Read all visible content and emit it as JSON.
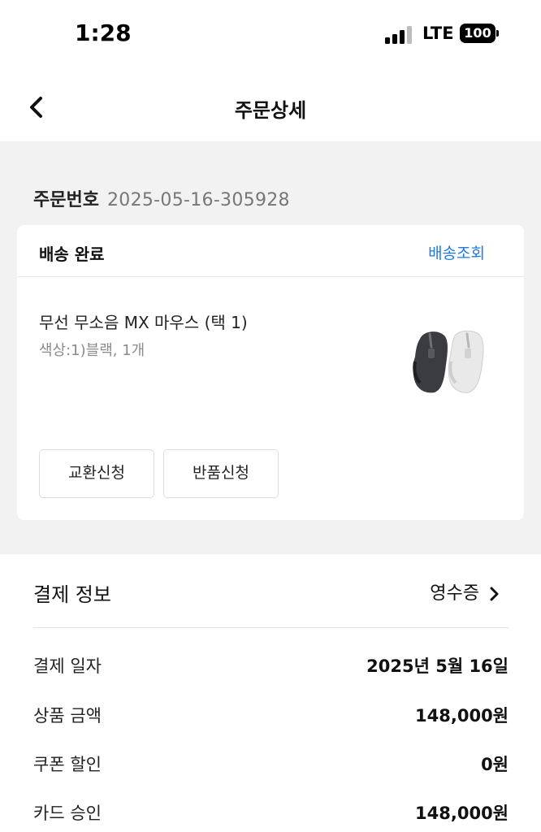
{
  "status_bar": {
    "time": "1:28",
    "network": "LTE",
    "battery": "100"
  },
  "nav": {
    "title": "주문상세",
    "back_icon": "chevron-left-icon"
  },
  "order": {
    "label": "주문번호",
    "number": "2025-05-16-305928"
  },
  "shipment": {
    "status": "배송 완료",
    "track_label": "배송조회",
    "product_name": "무선 무소음 MX 마우스 (택 1)",
    "product_option": "색상:1)블랙, 1개",
    "exchange_label": "교환신청",
    "return_label": "반품신청"
  },
  "payment": {
    "title": "결제 정보",
    "receipt_label": "영수증",
    "rows": [
      {
        "label": "결제 일자",
        "value": "2025년 5월 16일"
      },
      {
        "label": "상품 금액",
        "value": "148,000원"
      },
      {
        "label": "쿠폰 할인",
        "value": "0원"
      },
      {
        "label": "카드 승인",
        "value": "148,000원"
      }
    ]
  },
  "colors": {
    "accent": "#1f7ae0",
    "background_gray": "#f2f2f2"
  }
}
